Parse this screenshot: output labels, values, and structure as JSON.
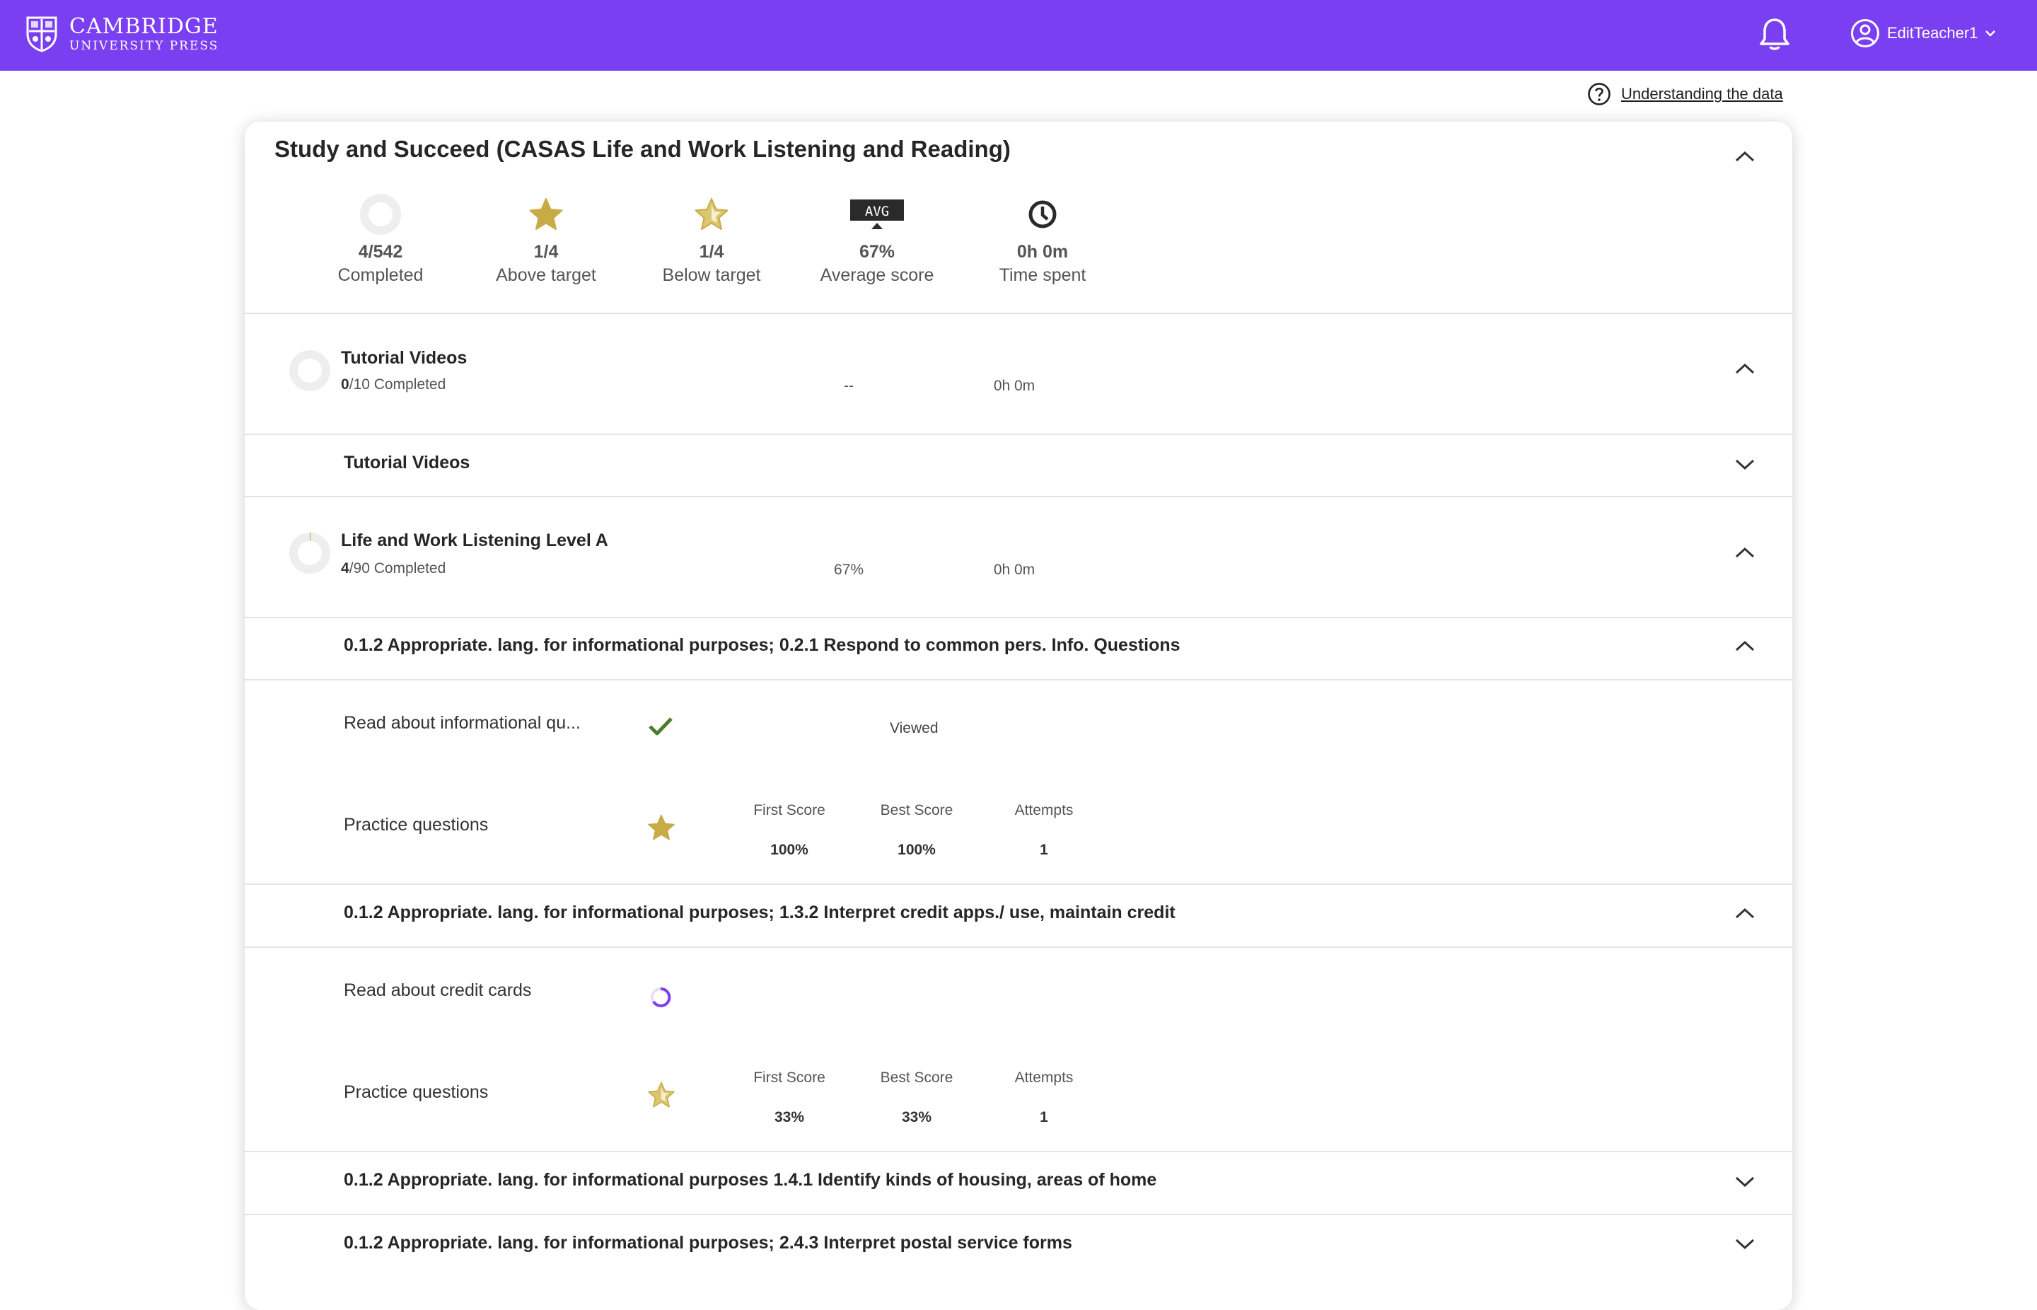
{
  "header": {
    "brand_line1": "CAMBRIDGE",
    "brand_line2": "UNIVERSITY PRESS",
    "user_name": "EditTeacher1",
    "bg_color": "#7b3ff2"
  },
  "help_link": "Understanding the data",
  "course": {
    "title": "Study and Succeed (CASAS Life and Work Listening and Reading)",
    "stats": [
      {
        "icon": "progress-ring-icon",
        "value": "4/542",
        "label": "Completed"
      },
      {
        "icon": "star-icon",
        "value": "1/4",
        "label": "Above target"
      },
      {
        "icon": "half-star-icon",
        "value": "1/4",
        "label": "Below target"
      },
      {
        "icon": "avg-monitor-icon",
        "icon_text": "AVG",
        "value": "67%",
        "label": "Average score"
      },
      {
        "icon": "clock-icon",
        "value": "0h 0m",
        "label": "Time spent"
      }
    ]
  },
  "units": [
    {
      "title": "Tutorial Videos",
      "done": "0",
      "total": "/10 Completed",
      "score": "--",
      "time": "0h 0m"
    },
    {
      "title": "Life and Work Listening Level A",
      "done": "4",
      "total": "/90 Completed",
      "score": "67%",
      "time": "0h 0m"
    }
  ],
  "sections": {
    "tutorial_videos": "Tutorial Videos",
    "s1": "0.1.2 Appropriate. lang. for informational purposes; 0.2.1 Respond to common pers. Info. Questions",
    "s2": "0.1.2 Appropriate. lang. for informational purposes; 1.3.2 Interpret credit apps./ use, maintain credit",
    "s3": "0.1.2 Appropriate. lang. for informational purposes 1.4.1 Identify kinds of housing, areas of home",
    "s4": "0.1.2 Appropriate. lang. for informational purposes; 2.4.3 Interpret postal service forms"
  },
  "items": {
    "s1_read": {
      "label": "Read about informational qu...",
      "status": "Viewed"
    },
    "s1_practice": {
      "label": "Practice questions",
      "first": "100%",
      "best": "100%",
      "attempts": "1"
    },
    "s2_read": {
      "label": "Read about credit cards"
    },
    "s2_practice": {
      "label": "Practice questions",
      "first": "33%",
      "best": "33%",
      "attempts": "1"
    }
  },
  "score_headers": {
    "first": "First Score",
    "best": "Best Score",
    "attempts": "Attempts"
  },
  "colors": {
    "accent": "#7b3ff2",
    "gold": "#c9ab46",
    "check": "#4a7d2b"
  }
}
